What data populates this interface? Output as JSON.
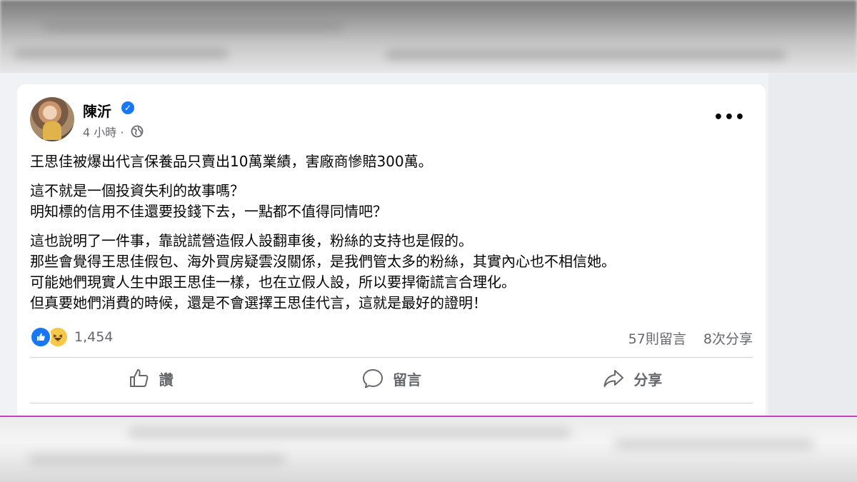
{
  "post": {
    "author": "陳沂",
    "time": "4 小時",
    "separator": "·",
    "paragraphs": [
      [
        "王思佳被爆出代言保養品只賣出10萬業績，害廠商慘賠300萬。"
      ],
      [
        "這不就是一個投資失利的故事嗎？",
        "明知標的信用不佳還要投錢下去，一點都不值得同情吧？"
      ],
      [
        "這也說明了一件事，靠說謊營造假人設翻車後，粉絲的支持也是假的。",
        "那些會覺得王思佳假包、海外買房疑雲沒關係，是我們管太多的粉絲，其實內心也不相信她。",
        "可能她們現實人生中跟王思佳一樣，也在立假人設，所以要捍衛謊言合理化。",
        "但真要她們消費的時候，還是不會選擇王思佳代言，這就是最好的證明！"
      ]
    ],
    "reaction_count": "1,454",
    "comments": "57則留言",
    "shares": "8次分享"
  },
  "actions": {
    "like": "讚",
    "comment": "留言",
    "share": "分享"
  },
  "icons": [
    "verified-badge-icon",
    "globe-icon",
    "more-options-icon",
    "like-reaction-icon",
    "haha-reaction-icon",
    "thumbs-up-icon",
    "comment-bubble-icon",
    "share-arrow-icon"
  ],
  "colors": {
    "accent": "#1877f2",
    "secondary_text": "#65676b",
    "text": "#050505",
    "haha": "#f7c846"
  }
}
